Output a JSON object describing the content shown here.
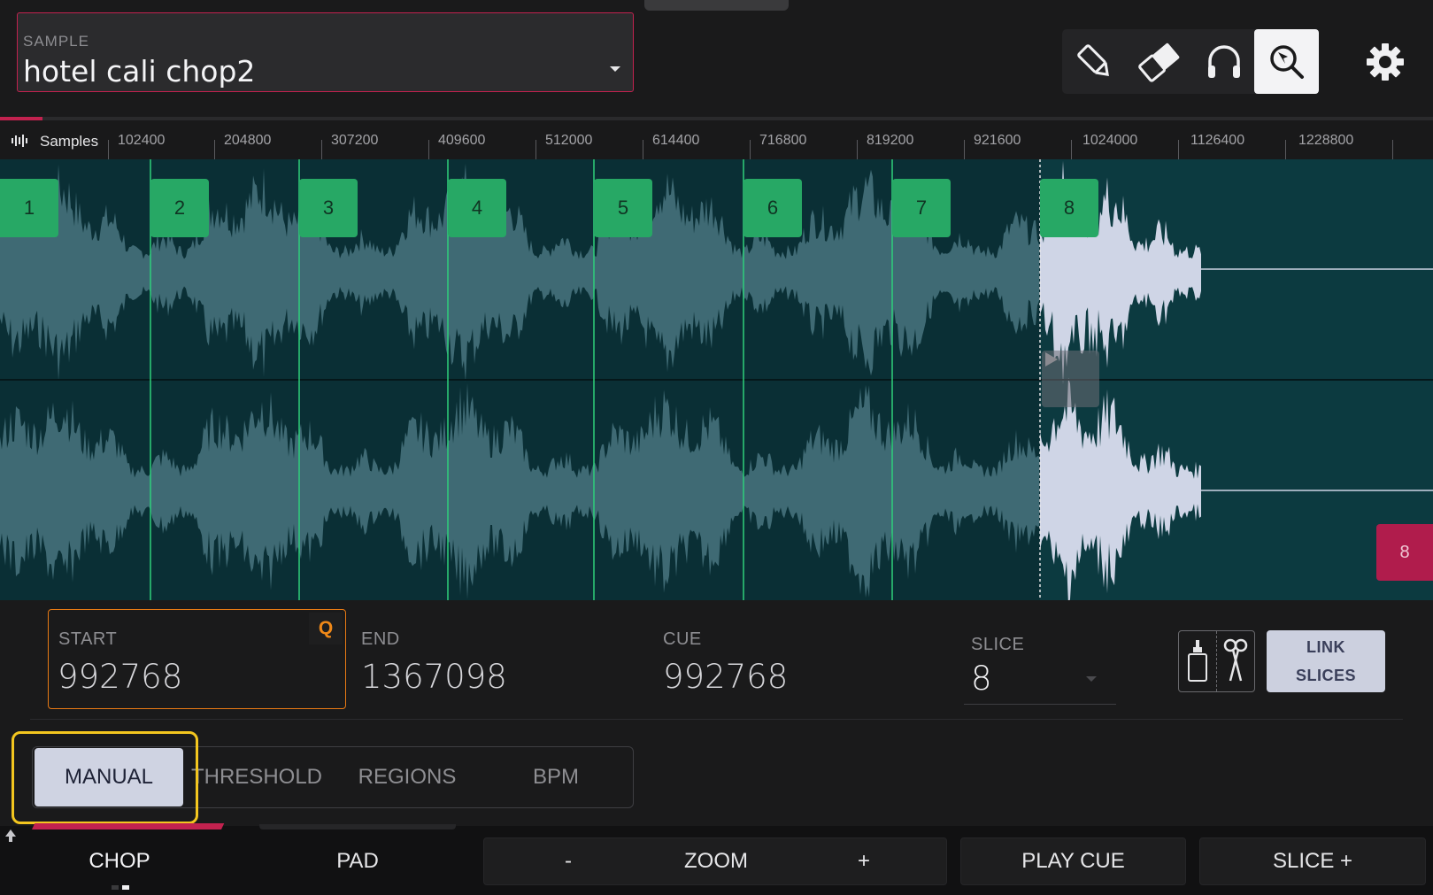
{
  "sample": {
    "label": "SAMPLE",
    "name": "hotel cali chop2"
  },
  "toolbar": {
    "tools": [
      "pencil-icon",
      "eraser-icon",
      "headphones-icon",
      "zoom-select-icon"
    ],
    "active_tool": "zoom-select-icon"
  },
  "ruler": {
    "unit_label": "Samples",
    "ticks": [
      "102400",
      "204800",
      "307200",
      "409600",
      "512000",
      "614400",
      "716800",
      "819200",
      "921600",
      "1024000",
      "1126400",
      "1228800"
    ]
  },
  "slices": {
    "tags": [
      "1",
      "2",
      "3",
      "4",
      "5",
      "6",
      "7",
      "8"
    ],
    "end_marker": "8"
  },
  "params": {
    "start": {
      "label": "START",
      "value": "992768",
      "quantize": "Q"
    },
    "end": {
      "label": "END",
      "value": "1367098"
    },
    "cue": {
      "label": "CUE",
      "value": "992768"
    },
    "slice": {
      "label": "SLICE",
      "value": "8"
    },
    "link_slices": {
      "line1": "LINK",
      "line2": "SLICES"
    }
  },
  "chop_modes": {
    "items": [
      "MANUAL",
      "THRESHOLD",
      "REGIONS",
      "BPM"
    ],
    "active": "MANUAL"
  },
  "bottom": {
    "chop": "CHOP",
    "pad": "PAD",
    "zoom_minus": "-",
    "zoom": "ZOOM",
    "zoom_plus": "+",
    "play_cue": "PLAY CUE",
    "slice_plus": "SLICE +"
  },
  "colors": {
    "accent_red": "#c2224f",
    "slice_green": "#27a865",
    "start_orange": "#e87a14",
    "highlight_yellow": "#f3c61f",
    "waveform_bg": "#0c3a40"
  }
}
